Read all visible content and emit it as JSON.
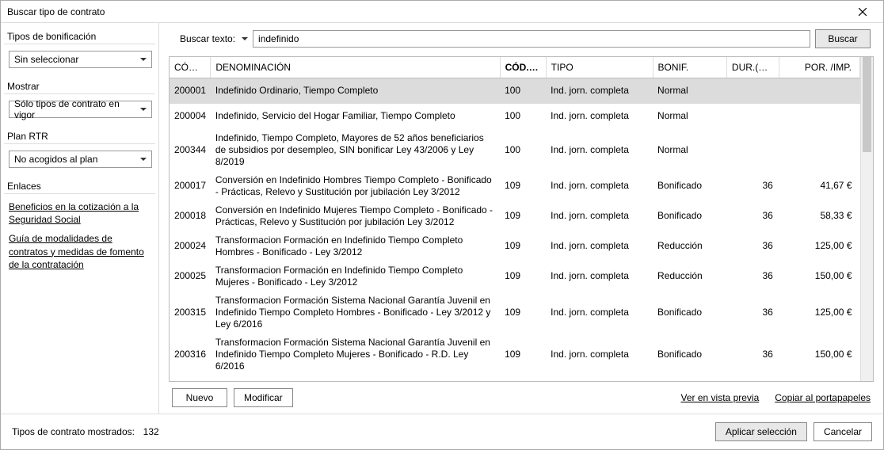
{
  "window": {
    "title": "Buscar tipo de contrato"
  },
  "sidebar": {
    "sections": {
      "bonif_head": "Tipos de bonificación",
      "bonif_value": "Sin seleccionar",
      "mostrar_head": "Mostrar",
      "mostrar_value": "Sólo tipos de contrato en vigor",
      "plan_head": "Plan RTR",
      "plan_value": "No acogidos al plan",
      "enlaces_head": "Enlaces"
    },
    "links": {
      "l1": "Beneficios en la cotización a la Seguridad Social",
      "l2": "Guía de modalidades de contratos y medidas de fomento de la contratación"
    }
  },
  "search": {
    "label": "Buscar texto:",
    "value": "indefinido",
    "button": "Buscar"
  },
  "columns": {
    "codi": "CÓDI...",
    "den": "DENOMINACIÓN",
    "codo": "CÓD.O...",
    "tipo": "TIPO",
    "bonif": "BONIF.",
    "dur": "DUR.(M...",
    "imp": "POR. /IMP."
  },
  "rows": [
    {
      "codi": "200001",
      "den": "Indefinido Ordinario, Tiempo Completo",
      "codo": "100",
      "tipo": "Ind. jorn. completa",
      "bonif": "Normal",
      "dur": "",
      "imp": ""
    },
    {
      "codi": "200004",
      "den": "Indefinido, Servicio del Hogar Familiar, Tiempo Completo",
      "codo": "100",
      "tipo": "Ind. jorn. completa",
      "bonif": "Normal",
      "dur": "",
      "imp": ""
    },
    {
      "codi": "200344",
      "den": "Indefinido, Tiempo Completo, Mayores de 52 años beneficiarios de subsidios por desempleo, SIN bonificar Ley 43/2006 y Ley 8/2019",
      "codo": "100",
      "tipo": "Ind. jorn. completa",
      "bonif": "Normal",
      "dur": "",
      "imp": ""
    },
    {
      "codi": "200017",
      "den": "Conversión en Indefinido Hombres Tiempo Completo - Bonificado - Prácticas, Relevo y Sustitución por jubilación Ley 3/2012",
      "codo": "109",
      "tipo": "Ind. jorn. completa",
      "bonif": "Bonificado",
      "dur": "36",
      "imp": "41,67 €"
    },
    {
      "codi": "200018",
      "den": "Conversión en Indefinido Mujeres Tiempo Completo - Bonificado - Prácticas, Relevo y Sustitución por jubilación Ley 3/2012",
      "codo": "109",
      "tipo": "Ind. jorn. completa",
      "bonif": "Bonificado",
      "dur": "36",
      "imp": "58,33 €"
    },
    {
      "codi": "200024",
      "den": "Transformacion Formación en Indefinido Tiempo Completo Hombres - Bonificado -  Ley 3/2012",
      "codo": "109",
      "tipo": "Ind. jorn. completa",
      "bonif": "Reducción",
      "dur": "36",
      "imp": "125,00 €"
    },
    {
      "codi": "200025",
      "den": "Transformacion Formación en Indefinido Tiempo Completo Mujeres - Bonificado -  Ley 3/2012",
      "codo": "109",
      "tipo": "Ind. jorn. completa",
      "bonif": "Reducción",
      "dur": "36",
      "imp": "150,00 €"
    },
    {
      "codi": "200315",
      "den": "Transformacion Formación Sistema Nacional Garantía Juvenil en Indefinido Tiempo Completo Hombres - Bonificado -  Ley 3/2012 y Ley 6/2016",
      "codo": "109",
      "tipo": "Ind. jorn. completa",
      "bonif": "Bonificado",
      "dur": "36",
      "imp": "125,00 €"
    },
    {
      "codi": "200316",
      "den": "Transformacion Formación Sistema Nacional Garantía Juvenil en Indefinido Tiempo Completo Mujeres - Bonificado -  R.D. Ley 6/2016",
      "codo": "109",
      "tipo": "Ind. jorn. completa",
      "bonif": "Bonificado",
      "dur": "36",
      "imp": "150,00 €"
    }
  ],
  "actions": {
    "nuevo": "Nuevo",
    "modificar": "Modificar",
    "ver_vista_previa": "Ver en vista previa",
    "copiar": "Copiar al portapapeles"
  },
  "footer": {
    "status_label": "Tipos de contrato mostrados:",
    "status_count": "132",
    "aplicar": "Aplicar selección",
    "cancelar": "Cancelar"
  }
}
